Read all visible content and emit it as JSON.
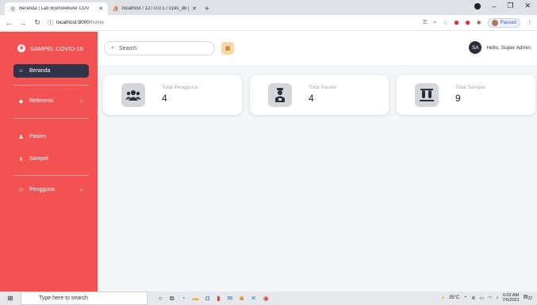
{
  "browser": {
    "tabs": [
      {
        "title": "Beranda | Lab Biomolekuler COV",
        "close": "✕",
        "active": true
      },
      {
        "title": "localhost / 127.0.0.1 / c19s_db | ",
        "close": "✕",
        "active": false
      }
    ],
    "new_tab": "+",
    "url_host": "localhost:8000",
    "url_path": "/home",
    "profile_label": "Paused"
  },
  "sidebar": {
    "brand": "SAMPEL COVID-19",
    "items": [
      {
        "label": "Beranda",
        "icon": "home-icon"
      },
      {
        "label": "Referensi",
        "icon": "tag-icon",
        "chevron": "›"
      },
      {
        "label": "Pasien",
        "icon": "user-icon"
      },
      {
        "label": "Sampel",
        "icon": "vials-icon"
      },
      {
        "label": "Pengguna",
        "icon": "users-icon",
        "chevron": "›"
      }
    ]
  },
  "topbar": {
    "search_placeholder": "Search",
    "avatar_initials": "SA",
    "greeting": "Hello, Super Admin"
  },
  "cards": [
    {
      "label": "Total Pengguna",
      "value": "4",
      "icon": "users-icon"
    },
    {
      "label": "Total Pasien",
      "value": "4",
      "icon": "patient-icon"
    },
    {
      "label": "Total Sampel",
      "value": "9",
      "icon": "vials-icon"
    }
  ],
  "taskbar": {
    "search_placeholder": "Type here to search",
    "temperature": "25°C",
    "time": "6:02 AM",
    "date": "7/5/2021",
    "notification_count": "22"
  },
  "colors": {
    "sidebar": "#f25252",
    "active_nav": "#2f3448",
    "card_icon_bg": "#d4d6dc",
    "grid_button": "#f6d8a9"
  }
}
